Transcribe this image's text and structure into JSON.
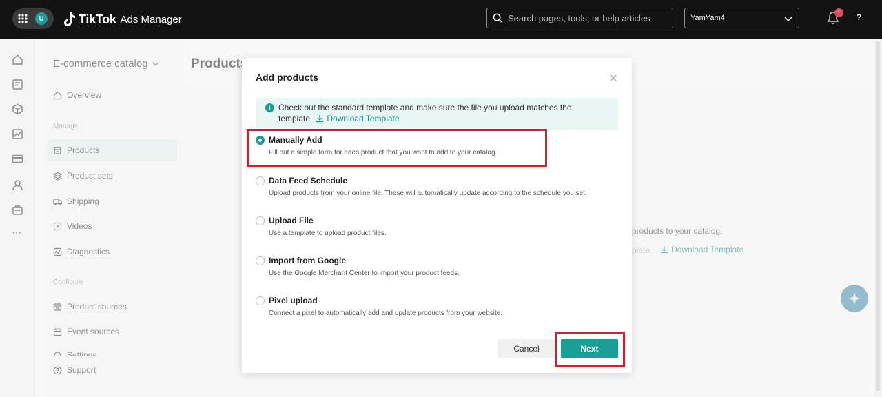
{
  "topbar": {
    "avatar_initial": "U",
    "brand": "TikTok",
    "product": "Ads Manager",
    "search_placeholder": "Search pages, tools, or help articles",
    "account_name": "YamYam4",
    "notification_count": "1",
    "help_label": "?"
  },
  "rail": {
    "icons": [
      "home-icon",
      "campaign-icon",
      "assets-icon",
      "reporting-icon",
      "payment-icon",
      "account-icon",
      "tools-icon",
      "more-icon"
    ],
    "more_label": "···"
  },
  "sidebar": {
    "catalog_title": "E-commerce catalog",
    "overview": "Overview",
    "manage_label": "Manage",
    "products": "Products",
    "product_sets": "Product sets",
    "shipping": "Shipping",
    "videos": "Videos",
    "diagnostics": "Diagnostics",
    "configure_label": "Configure",
    "product_sources": "Product sources",
    "event_sources": "Event sources",
    "settings_partial": "Settings",
    "support": "Support"
  },
  "main": {
    "title": "Products",
    "bg_text1": "products to your catalog.",
    "bg_text2": "plate.",
    "bg_link": "Download Template"
  },
  "modal": {
    "title": "Add products",
    "info_line1": "Check out the standard template and make sure the file you upload matches the",
    "info_line2": "template.",
    "info_link": "Download Template",
    "options": [
      {
        "title": "Manually Add",
        "desc": "Fill out a simple form for each product that you want to add to your catalog.",
        "selected": true
      },
      {
        "title": "Data Feed Schedule",
        "desc": "Upload products from your online file. These will automatically update according to the schedule you set.",
        "selected": false
      },
      {
        "title": "Upload File",
        "desc": "Use a template to upload product files.",
        "selected": false
      },
      {
        "title": "Import from Google",
        "desc": "Use the Google Merchant Center to import your product feeds.",
        "selected": false
      },
      {
        "title": "Pixel upload",
        "desc": "Connect a pixel to automatically add and update products from your website.",
        "selected": false
      }
    ],
    "cancel_label": "Cancel",
    "next_label": "Next"
  },
  "colors": {
    "accent": "#1a9e95",
    "highlight": "#d0202a",
    "topbar": "#121212"
  }
}
